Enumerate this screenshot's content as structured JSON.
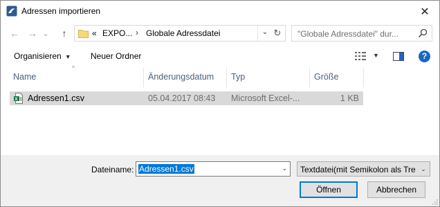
{
  "window": {
    "title": "Adressen importieren",
    "close_glyph": "✕"
  },
  "nav": {
    "back_glyph": "←",
    "forward_glyph": "→",
    "recent_glyph": "⌄",
    "up_glyph": "↑"
  },
  "address": {
    "overflow": "«",
    "crumbs": [
      "EXPO...",
      "Globale Adressdatei"
    ],
    "separator": "›",
    "dropdown_glyph": "⌄",
    "refresh_glyph": "↻"
  },
  "search": {
    "placeholder": "\"Globale Adressdatei\" dur...",
    "icon": "search-icon"
  },
  "toolbar": {
    "organize_label": "Organisieren",
    "new_folder_label": "Neuer Ordner",
    "help_label": "?"
  },
  "columns": [
    {
      "label": "Name"
    },
    {
      "label": "Änderungsdatum"
    },
    {
      "label": "Typ"
    },
    {
      "label": "Größe"
    }
  ],
  "files": [
    {
      "name": "Adressen1.csv",
      "modified": "05.04.2017 08:43",
      "type": "Microsoft Excel-...",
      "size": "1 KB",
      "icon": "excel-csv-icon"
    }
  ],
  "bottom": {
    "filename_label": "Dateiname:",
    "filename_value": "Adressen1.csv",
    "filter_value": "Textdatei(mit Semikolon als Tre",
    "open_label": "Öffnen",
    "cancel_label": "Abbrechen"
  },
  "colors": {
    "accent": "#0078d7",
    "header_text": "#4c607a",
    "selected_row": "#d9d9d9",
    "panel": "#f0f0f0"
  }
}
